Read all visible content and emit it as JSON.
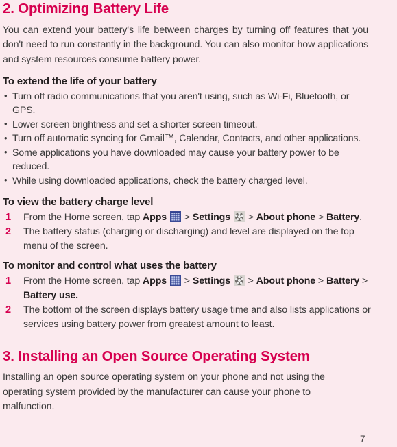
{
  "page": {
    "number": "7",
    "background_color": "#fbeaee",
    "accent_color": "#d6004f",
    "text_color": "#3b3b3b"
  },
  "sections": [
    {
      "title": "2. Optimizing Battery Life",
      "intro": "You can extend your battery's life between charges by turning off features that you don't need to run constantly in the background. You can also monitor how applications and system resources consume battery power.",
      "sub1": {
        "heading": "To extend the life of your battery",
        "bullets": [
          "Turn off radio communications that you aren't using, such as Wi-Fi, Bluetooth, or GPS.",
          "Lower screen brightness and set a shorter screen timeout.",
          "Turn off automatic syncing for Gmail™, Calendar, Contacts, and other applications.",
          "Some applications you have downloaded may cause your battery power to be reduced.",
          "While using downloaded applications, check the battery charged level."
        ]
      },
      "sub2": {
        "heading": "To view the battery charge level",
        "steps": [
          {
            "num": "1",
            "parts": [
              {
                "t": "From the Home screen, tap ",
                "s": "plain"
              },
              {
                "t": "Apps",
                "s": "bold"
              },
              {
                "t": " ",
                "s": "plain"
              },
              {
                "t": "apps-grid-icon",
                "s": "icon"
              },
              {
                "t": " > ",
                "s": "plain"
              },
              {
                "t": "Settings",
                "s": "bold"
              },
              {
                "t": " ",
                "s": "plain"
              },
              {
                "t": "settings-gear-icon",
                "s": "icon"
              },
              {
                "t": " > ",
                "s": "plain"
              },
              {
                "t": "About phone",
                "s": "bold"
              },
              {
                "t": " > ",
                "s": "plain"
              },
              {
                "t": "Battery",
                "s": "bold"
              },
              {
                "t": ".",
                "s": "plain"
              }
            ]
          },
          {
            "num": "2",
            "parts": [
              {
                "t": "The battery status (charging or discharging) and level are displayed on the top menu of the screen.",
                "s": "plain"
              }
            ]
          }
        ]
      },
      "sub3": {
        "heading": "To monitor and control what uses the battery",
        "steps": [
          {
            "num": "1",
            "parts": [
              {
                "t": "From the Home screen, tap ",
                "s": "plain"
              },
              {
                "t": "Apps",
                "s": "bold"
              },
              {
                "t": " ",
                "s": "plain"
              },
              {
                "t": "apps-grid-icon",
                "s": "icon"
              },
              {
                "t": " > ",
                "s": "plain"
              },
              {
                "t": "Settings",
                "s": "bold"
              },
              {
                "t": " ",
                "s": "plain"
              },
              {
                "t": "settings-gear-icon",
                "s": "icon"
              },
              {
                "t": " > ",
                "s": "plain"
              },
              {
                "t": "About phone",
                "s": "bold"
              },
              {
                "t": " > ",
                "s": "plain"
              },
              {
                "t": "Battery",
                "s": "bold"
              },
              {
                "t": " > ",
                "s": "plain"
              },
              {
                "t": "Battery use.",
                "s": "bold"
              }
            ]
          },
          {
            "num": "2",
            "parts": [
              {
                "t": "The bottom of the screen displays battery usage time and also lists applications or services using battery power from greatest amount to least.",
                "s": "plain"
              }
            ]
          }
        ]
      }
    },
    {
      "title": "3. Installing an Open Source Operating System",
      "intro": "Installing an open source operating system on your phone and not using the operating system provided by the manufacturer can cause your phone to malfunction."
    }
  ],
  "icons": {
    "apps_grid": "apps-grid-icon",
    "settings_gear": "settings-gear-icon"
  }
}
